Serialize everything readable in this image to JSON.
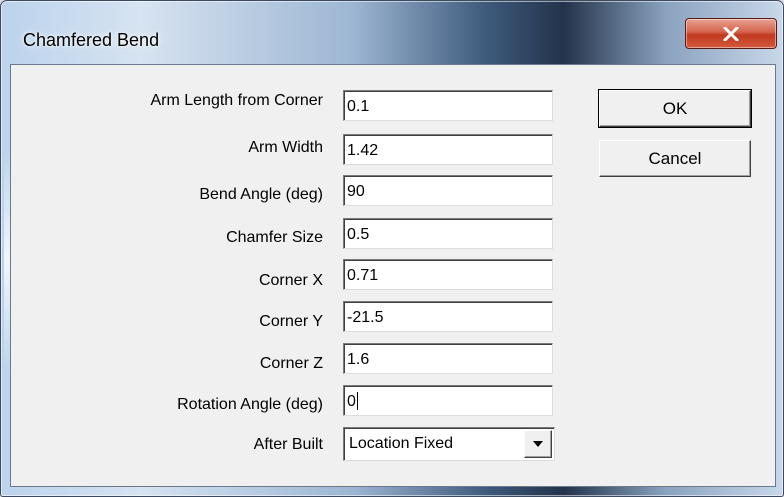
{
  "window": {
    "title": "Chamfered Bend",
    "close_icon": "close-x-icon"
  },
  "fields": [
    {
      "label": "Arm Length from Corner",
      "value": "0.1"
    },
    {
      "label": "Arm Width",
      "value": "1.42"
    },
    {
      "label": "Bend Angle (deg)",
      "value": "90"
    },
    {
      "label": "Chamfer Size",
      "value": "0.5"
    },
    {
      "label": "Corner X",
      "value": "0.71"
    },
    {
      "label": "Corner Y",
      "value": "-21.5"
    },
    {
      "label": "Corner Z",
      "value": "1.6"
    },
    {
      "label": "Rotation Angle (deg)",
      "value": "0"
    }
  ],
  "after_built": {
    "label": "After Built",
    "selected": "Location Fixed",
    "arrow_icon": "dropdown-arrow-icon"
  },
  "buttons": {
    "ok_label": "OK",
    "cancel_label": "Cancel"
  },
  "colors": {
    "dialog_bg": "#f0f0f0",
    "close_button": "#c0391f",
    "input_bg": "#ffffff"
  }
}
